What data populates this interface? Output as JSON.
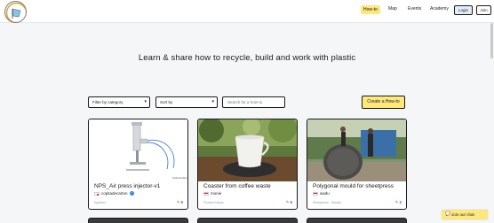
{
  "header": {
    "logo_alt": "Precious Plastic",
    "nav": [
      "How-to",
      "Map",
      "Events",
      "Academy"
    ],
    "login_label": "Login",
    "join_label": "Join",
    "active_color": "#fee77b"
  },
  "hero": {
    "title": "Learn & share how to recycle, build and work with plastic"
  },
  "filters": {
    "category_label": "Filter by category",
    "sort_label": "Sort by",
    "search_placeholder": "Search for a how-to",
    "create_label": "Create a How-to"
  },
  "cards": [
    {
      "title": "NPS_Air press injector-v1",
      "author": "copitadecarton",
      "flag": "kr",
      "verified": true,
      "tags": "Injection",
      "useful": "6"
    },
    {
      "title": "Coaster from coffee waste",
      "author": "monie",
      "flag": "id",
      "verified": false,
      "tags": "Product Hacks",
      "useful": "5"
    },
    {
      "title": "Polygonal mould for sheetpress",
      "author": "wadu",
      "flag": "id",
      "verified": false,
      "tags": "Sheetpress · Moulds",
      "useful": "2"
    }
  ],
  "chat": {
    "label": "Join our chat"
  },
  "icons": {
    "chevron": "chevron-down-icon",
    "useful": "useful-icon",
    "chat": "chat-icon",
    "verified": "verified-badge-icon"
  }
}
